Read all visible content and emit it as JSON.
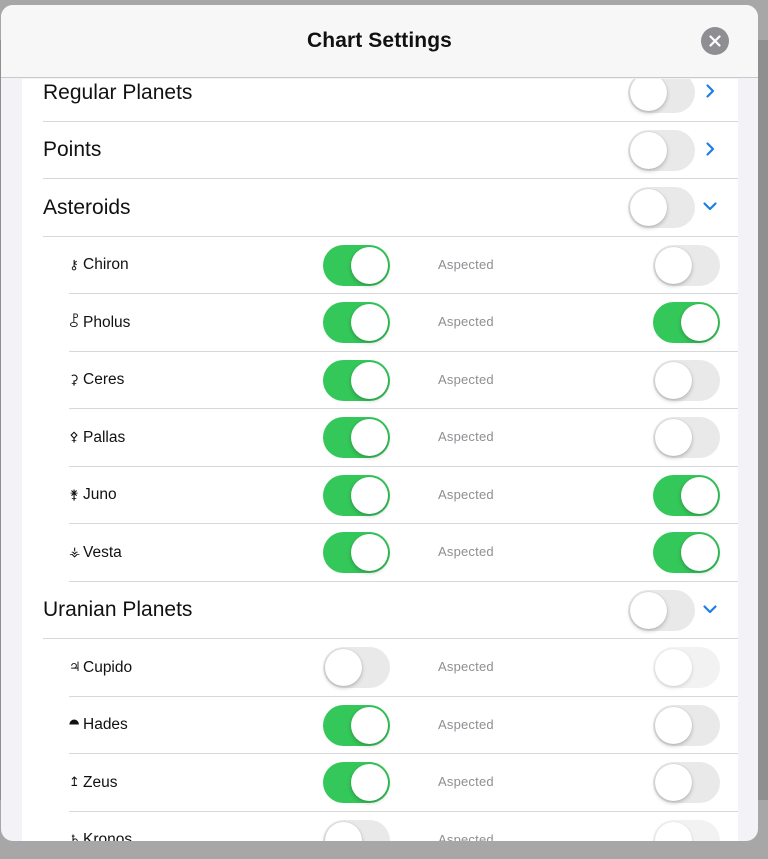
{
  "header": {
    "title": "Chart Settings"
  },
  "colors": {
    "toggle_on": "#34c759",
    "toggle_off": "#e9e9ea",
    "accent": "#1a7fe6"
  },
  "icons": {
    "close": "close-icon",
    "chevron_right": "chevron-right-icon",
    "chevron_down": "chevron-down-icon"
  },
  "sections": [
    {
      "label": "Regular Planets",
      "enabled": false,
      "expanded": false
    },
    {
      "label": "Points",
      "enabled": false,
      "expanded": false
    },
    {
      "label": "Asteroids",
      "enabled": false,
      "expanded": true,
      "items": [
        {
          "glyph": "⚷",
          "name": "Chiron",
          "on": true,
          "aspect_label": "Aspected",
          "aspected": false
        },
        {
          "glyph": "⯛",
          "name": "Pholus",
          "on": true,
          "aspect_label": "Aspected",
          "aspected": true
        },
        {
          "glyph": "⚳",
          "name": "Ceres",
          "on": true,
          "aspect_label": "Aspected",
          "aspected": false
        },
        {
          "glyph": "⚴",
          "name": "Pallas",
          "on": true,
          "aspect_label": "Aspected",
          "aspected": false
        },
        {
          "glyph": "⚵",
          "name": "Juno",
          "on": true,
          "aspect_label": "Aspected",
          "aspected": true
        },
        {
          "glyph": "⚶",
          "name": "Vesta",
          "on": true,
          "aspect_label": "Aspected",
          "aspected": true
        }
      ]
    },
    {
      "label": "Uranian Planets",
      "enabled": false,
      "expanded": true,
      "items": [
        {
          "glyph": "♃",
          "name": "Cupido",
          "on": false,
          "aspect_label": "Aspected",
          "aspected": false
        },
        {
          "glyph": "⯊",
          "name": "Hades",
          "on": true,
          "aspect_label": "Aspected",
          "aspected": false
        },
        {
          "glyph": "↥",
          "name": "Zeus",
          "on": true,
          "aspect_label": "Aspected",
          "aspected": false
        },
        {
          "glyph": "♄",
          "name": "Kronos",
          "on": false,
          "aspect_label": "Aspected",
          "aspected": false
        }
      ]
    }
  ]
}
